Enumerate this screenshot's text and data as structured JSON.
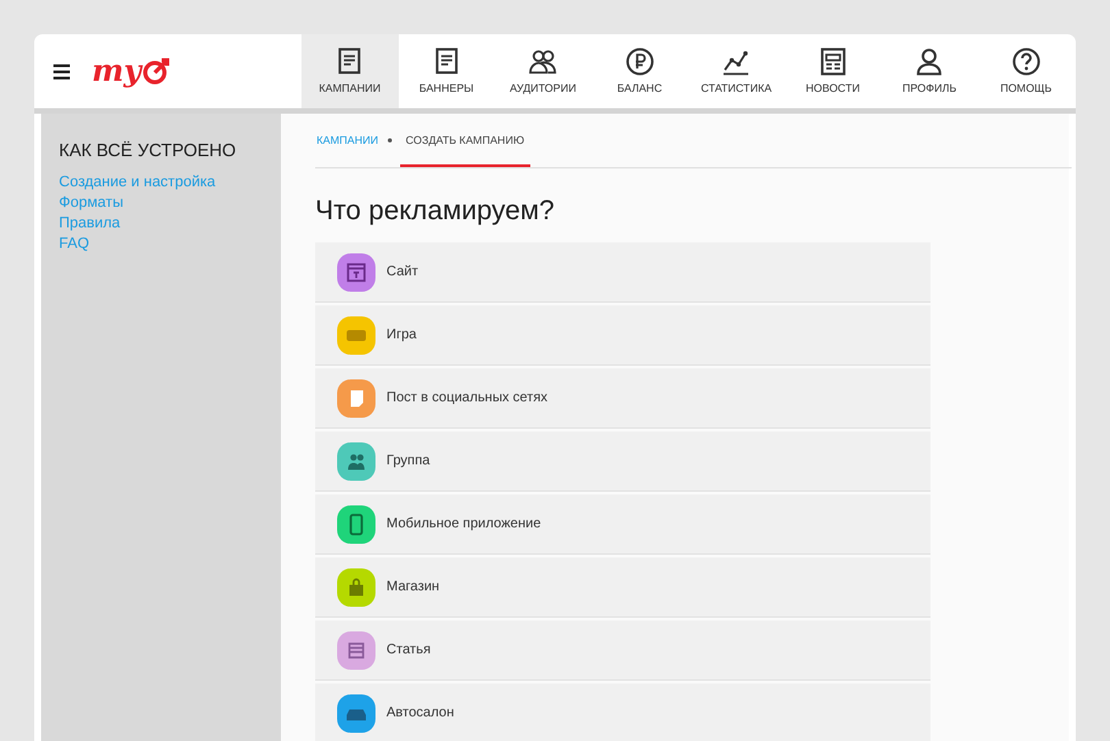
{
  "header": {
    "logo": "my",
    "nav": [
      {
        "label": "КАМПАНИИ",
        "selected": true
      },
      {
        "label": "БАННЕРЫ",
        "selected": false
      },
      {
        "label": "АУДИТОРИИ",
        "selected": false
      },
      {
        "label": "БАЛАНС",
        "selected": false
      },
      {
        "label": "СТАТИСТИКА",
        "selected": false
      },
      {
        "label": "НОВОСТИ",
        "selected": false
      },
      {
        "label": "ПРОФИЛЬ",
        "selected": false
      },
      {
        "label": "ПОМОЩЬ",
        "selected": false
      }
    ]
  },
  "sidebar": {
    "title": "КАК ВСЁ УСТРОЕНО",
    "links": [
      "Создание и настройка",
      "Форматы",
      "Правила",
      "FAQ"
    ]
  },
  "breadcrumb": [
    {
      "label": "КАМПАНИИ",
      "selected": false
    },
    {
      "label": "СОЗДАТЬ КАМПАНИЮ",
      "selected": true
    }
  ],
  "heading": "Что рекламируем?",
  "options": [
    {
      "label": "Сайт",
      "color": "#c07ee8"
    },
    {
      "label": "Игра",
      "color": "#f5c400"
    },
    {
      "label": "Пост в социальных сетях",
      "color": "#f59a4a"
    },
    {
      "label": "Группа",
      "color": "#4ec9b8"
    },
    {
      "label": "Мобильное приложение",
      "color": "#1fd47a"
    },
    {
      "label": "Магазин",
      "color": "#b5d900"
    },
    {
      "label": "Статья",
      "color": "#d9a9e0"
    },
    {
      "label": "Автосалон",
      "color": "#1ea2e8"
    }
  ]
}
